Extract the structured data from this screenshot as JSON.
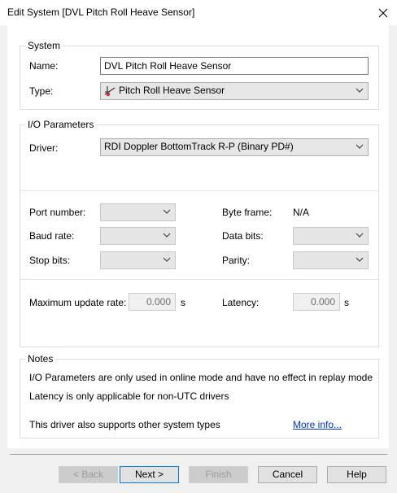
{
  "window": {
    "title": "Edit System [DVL Pitch Roll Heave Sensor]"
  },
  "system": {
    "legend": "System",
    "name_label": "Name:",
    "name_value": "DVL Pitch Roll Heave Sensor",
    "type_label": "Type:",
    "type_value": "Pitch Roll Heave Sensor"
  },
  "io": {
    "legend": "I/O Parameters",
    "driver_label": "Driver:",
    "driver_value": "RDI Doppler BottomTrack R-P (Binary PD#)",
    "port_label": "Port number:",
    "baud_label": "Baud rate:",
    "stop_label": "Stop bits:",
    "byteframe_label": "Byte frame:",
    "byteframe_value": "N/A",
    "databits_label": "Data bits:",
    "parity_label": "Parity:",
    "max_rate_label": "Maximum update rate:",
    "max_rate_value": "0.000",
    "max_rate_unit": "s",
    "latency_label": "Latency:",
    "latency_value": "0.000",
    "latency_unit": "s"
  },
  "notes": {
    "legend": "Notes",
    "line1": "I/O Parameters are only used in online mode and have no effect in replay mode",
    "line2": "Latency is only applicable for non-UTC drivers",
    "line3": "This driver also supports other system types",
    "link": "More info..."
  },
  "buttons": {
    "back": "< Back",
    "next": "Next >",
    "finish": "Finish",
    "cancel": "Cancel",
    "help": "Help"
  },
  "icons": {
    "close": "close-icon",
    "dropdown": "chevron-down-icon",
    "type": "pitch-roll-heave-icon"
  },
  "colors": {
    "link": "#0033cc",
    "default_button_border": "#0078d7"
  }
}
